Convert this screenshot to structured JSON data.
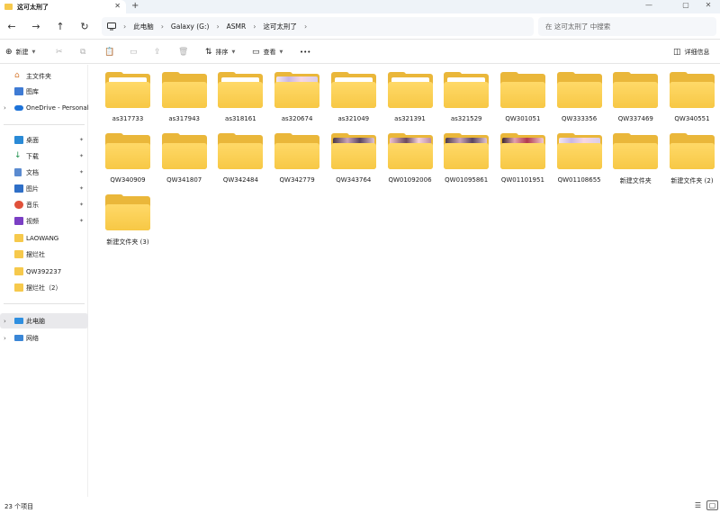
{
  "window": {
    "tab_title": "这可太刑了",
    "new_tab": "+",
    "close_tab": "✕",
    "min": "—",
    "max": "▢",
    "close": "✕"
  },
  "nav": {
    "back": "←",
    "forward": "→",
    "up": "↑",
    "refresh": "↻",
    "breadcrumb": [
      "此电脑",
      "Galaxy (G:)",
      "ASMR",
      "这可太刑了"
    ],
    "search_placeholder": "在 这可太刑了 中搜索"
  },
  "commands": {
    "new": "新建",
    "sort": "排序",
    "view": "查看",
    "more": "•••",
    "details": "详细信息"
  },
  "sidebar": {
    "top": [
      {
        "label": "主文件夹",
        "icon": "home-icon"
      },
      {
        "label": "图库",
        "icon": "gallery-icon"
      },
      {
        "label": "OneDrive - Personal",
        "icon": "cloud-icon"
      }
    ],
    "pinned": [
      {
        "label": "桌面",
        "icon": "desktop-icon"
      },
      {
        "label": "下载",
        "icon": "download-icon"
      },
      {
        "label": "文档",
        "icon": "documents-icon"
      },
      {
        "label": "图片",
        "icon": "pictures-icon"
      },
      {
        "label": "音乐",
        "icon": "music-icon"
      },
      {
        "label": "视频",
        "icon": "videos-icon"
      },
      {
        "label": "LAOWANG",
        "icon": "folder-icon"
      },
      {
        "label": "摆烂社",
        "icon": "folder-icon"
      },
      {
        "label": "QW392237",
        "icon": "folder-icon"
      },
      {
        "label": "摆烂社（2）",
        "icon": "folder-icon"
      }
    ],
    "bottom": [
      {
        "label": "此电脑",
        "icon": "this-pc-icon"
      },
      {
        "label": "网络",
        "icon": "network-icon"
      }
    ],
    "pin_glyph": "📌"
  },
  "folders": [
    {
      "name": "as317733",
      "preview": "doc"
    },
    {
      "name": "as317943",
      "preview": "none"
    },
    {
      "name": "as318161",
      "preview": "photo"
    },
    {
      "name": "as320674",
      "preview": "art-light"
    },
    {
      "name": "as321049",
      "preview": "doc"
    },
    {
      "name": "as321391",
      "preview": "doc"
    },
    {
      "name": "as321529",
      "preview": "doc"
    },
    {
      "name": "QW301051",
      "preview": "none"
    },
    {
      "name": "QW333356",
      "preview": "none"
    },
    {
      "name": "QW337469",
      "preview": "none"
    },
    {
      "name": "QW340551",
      "preview": "none"
    },
    {
      "name": "QW340909",
      "preview": "none"
    },
    {
      "name": "QW341807",
      "preview": "none"
    },
    {
      "name": "QW342484",
      "preview": "none"
    },
    {
      "name": "QW342779",
      "preview": "none"
    },
    {
      "name": "QW343764",
      "preview": "art-dark"
    },
    {
      "name": "QW01092006",
      "preview": "art-pink"
    },
    {
      "name": "QW01095861",
      "preview": "art-dark"
    },
    {
      "name": "QW01101951",
      "preview": "art-red"
    },
    {
      "name": "QW01108655",
      "preview": "art-light"
    },
    {
      "name": "新建文件夹",
      "preview": "none"
    },
    {
      "name": "新建文件夹 (2)",
      "preview": "none"
    },
    {
      "name": "新建文件夹 (3)",
      "preview": "none"
    }
  ],
  "status": {
    "count": "23 个项目",
    "view_details": "☰",
    "view_tiles": "▢"
  },
  "colors": {
    "folder_front": "#f7c845",
    "folder_back": "#eab73a",
    "accent": "#0067c0"
  }
}
